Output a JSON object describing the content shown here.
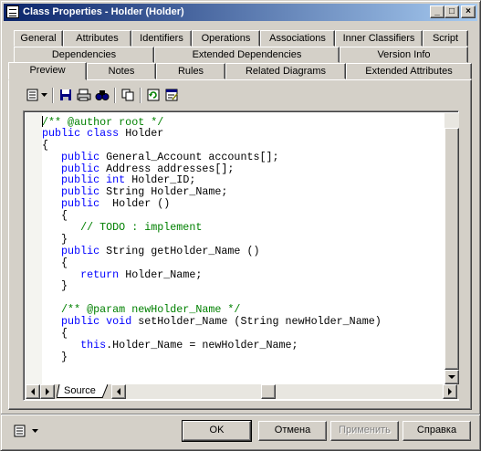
{
  "window": {
    "title": "Class Properties - Holder (Holder)",
    "controls": {
      "minimize": "_",
      "maximize": "□",
      "close": "×"
    }
  },
  "tabs": {
    "row1": [
      "General",
      "Attributes",
      "Identifiers",
      "Operations",
      "Associations",
      "Inner Classifiers",
      "Script"
    ],
    "row2": [
      "Dependencies",
      "Extended Dependencies",
      "Version Info"
    ],
    "row3": [
      "Preview",
      "Notes",
      "Rules",
      "Related Diagrams",
      "Extended Attributes"
    ],
    "active": "Preview"
  },
  "toolbar": {
    "icons": [
      "editor-menu-icon",
      "dropdown-arrow-icon",
      "save-icon",
      "print-icon",
      "find-icon",
      "copy-icon",
      "refresh-icon",
      "properties-icon"
    ]
  },
  "code": {
    "lines": [
      [
        {
          "t": "/** @author root */",
          "c": "cm"
        }
      ],
      [
        {
          "t": "public",
          "c": "kw"
        },
        {
          "t": " "
        },
        {
          "t": "class",
          "c": "kw"
        },
        {
          "t": " Holder"
        }
      ],
      [
        {
          "t": "{"
        }
      ],
      [
        {
          "t": "   "
        },
        {
          "t": "public",
          "c": "kw"
        },
        {
          "t": " General_Account accounts[];"
        }
      ],
      [
        {
          "t": "   "
        },
        {
          "t": "public",
          "c": "kw"
        },
        {
          "t": " Address addresses[];"
        }
      ],
      [
        {
          "t": "   "
        },
        {
          "t": "public",
          "c": "kw"
        },
        {
          "t": " "
        },
        {
          "t": "int",
          "c": "kw"
        },
        {
          "t": " Holder_ID;"
        }
      ],
      [
        {
          "t": "   "
        },
        {
          "t": "public",
          "c": "kw"
        },
        {
          "t": " String Holder_Name;"
        }
      ],
      [
        {
          "t": "   "
        },
        {
          "t": "public",
          "c": "kw"
        },
        {
          "t": "  Holder ()"
        }
      ],
      [
        {
          "t": "   {"
        }
      ],
      [
        {
          "t": "      "
        },
        {
          "t": "// TODO : implement",
          "c": "cm"
        }
      ],
      [
        {
          "t": "   }"
        }
      ],
      [
        {
          "t": "   "
        },
        {
          "t": "public",
          "c": "kw"
        },
        {
          "t": " String getHolder_Name ()"
        }
      ],
      [
        {
          "t": "   {"
        }
      ],
      [
        {
          "t": "      "
        },
        {
          "t": "return",
          "c": "kw"
        },
        {
          "t": " Holder_Name;"
        }
      ],
      [
        {
          "t": "   }"
        }
      ],
      [
        {
          "t": ""
        }
      ],
      [
        {
          "t": "   "
        },
        {
          "t": "/** @param newHolder_Name */",
          "c": "cm"
        }
      ],
      [
        {
          "t": "   "
        },
        {
          "t": "public",
          "c": "kw"
        },
        {
          "t": " "
        },
        {
          "t": "void",
          "c": "kw"
        },
        {
          "t": " setHolder_Name (String newHolder_Name)"
        }
      ],
      [
        {
          "t": "   {"
        }
      ],
      [
        {
          "t": "      "
        },
        {
          "t": "this",
          "c": "kw"
        },
        {
          "t": ".Holder_Name = newHolder_Name;"
        }
      ],
      [
        {
          "t": "   }"
        }
      ]
    ]
  },
  "editor_tab": "Source",
  "buttons": {
    "ok": "OK",
    "cancel": "Отмена",
    "apply": "Применить",
    "help": "Справка"
  },
  "colors": {
    "keyword": "#0000ff",
    "comment": "#008000",
    "title_start": "#0a246a",
    "title_end": "#a6caf0"
  }
}
